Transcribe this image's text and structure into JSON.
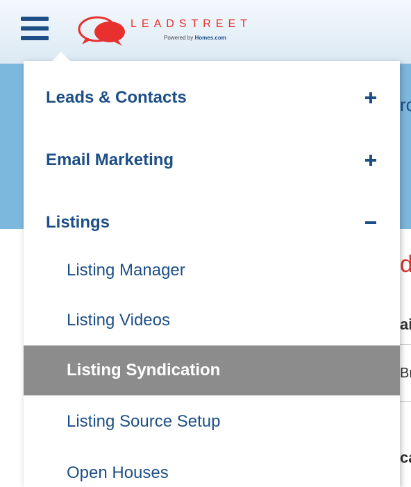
{
  "brand": {
    "name": "LEADSTREET",
    "powered_prefix": "Powered by",
    "powered_brand": "Homes.com",
    "logo_color": "#e8312f"
  },
  "colors": {
    "menu_text": "#1d4f86",
    "active_bg": "#8c8c8c",
    "header_band": "#7cb8dd"
  },
  "menu": {
    "sections": [
      {
        "label": "Leads & Contacts",
        "toggle": "+",
        "expanded": false
      },
      {
        "label": "Email Marketing",
        "toggle": "+",
        "expanded": false
      },
      {
        "label": "Listings",
        "toggle": "−",
        "expanded": true
      }
    ],
    "listings_items": [
      {
        "label": "Listing Manager",
        "active": false
      },
      {
        "label": "Listing Videos",
        "active": false
      },
      {
        "label": "Listing Syndication",
        "active": true
      },
      {
        "label": "Listing Source Setup",
        "active": false
      },
      {
        "label": "Open Houses",
        "active": false
      }
    ]
  },
  "background_peek": [
    "rc",
    "de",
    "ai",
    "Br",
    "ca"
  ]
}
